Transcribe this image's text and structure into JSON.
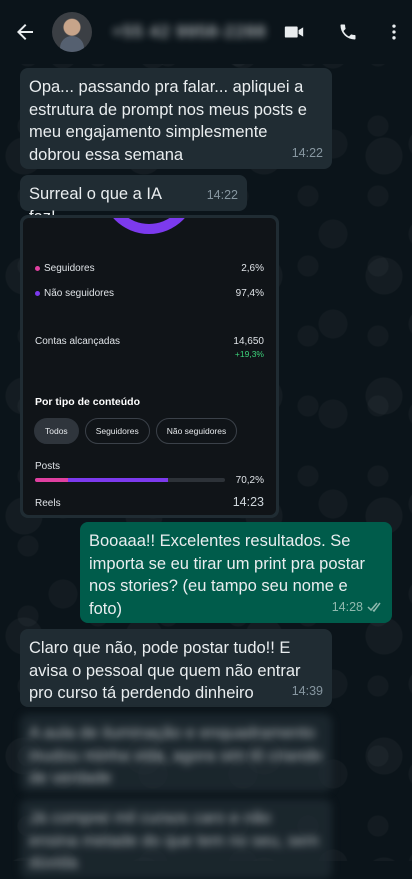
{
  "header": {
    "contact_name": "+55 42 9958-2288",
    "icons": {
      "back": "arrow-left-icon",
      "video": "video-camera-icon",
      "call": "phone-icon",
      "menu": "more-vertical-icon"
    }
  },
  "messages": [
    {
      "type": "in",
      "text": "Opa... passando pra falar... apliquei a estrutura de prompt nos meus posts e meu engajamento simplesmente dobrou essa semana",
      "time": "14:22"
    },
    {
      "type": "in",
      "text": "Surreal o que a IA faz!",
      "time": "14:22"
    },
    {
      "type": "in",
      "text": "Booaaa!! Excelentes resultados. Se importa se eu tirar um print pra postar nos stories? (eu tampo seu nome e foto)",
      "time": "14:28"
    },
    {
      "type": "in",
      "text": "Claro que não, pode postar tudo!! E avisa o pessoal que quem não entrar pro curso tá perdendo dinheiro",
      "time": "14:39"
    },
    {
      "type": "in",
      "text": "A aula de iluminação e enquadramento mudou minha vida, agora sim tô criando de verdade",
      "time": ""
    },
    {
      "type": "in",
      "text": "Já comprei mil cursos caro e não ensina metade do que tem no seu, sem dúvida",
      "time": ""
    }
  ],
  "screenshot": {
    "seguidores_label": "Seguidores",
    "seguidores_value": "2,6%",
    "nao_seguidores_label": "Não seguidores",
    "nao_seguidores_value": "97,4%",
    "contas_label": "Contas alcançadas",
    "contas_value": "14,650",
    "contas_change": "+19,3%",
    "section_title": "Por tipo de conteúdo",
    "chips": [
      "Todos",
      "Seguidores",
      "Não seguidores"
    ],
    "posts_label": "Posts",
    "posts_value": "70,2%",
    "posts_fraction": 0.702,
    "posts_seguidores_fraction": 0.25,
    "reels_label": "Reels",
    "time": "14:23"
  },
  "colors": {
    "incoming": "#202c33",
    "outgoing": "#005c4b",
    "background": "#0b141a",
    "accent_pink": "#e040a0",
    "accent_purple": "#7c3aed",
    "green": "#3dd17a"
  },
  "read_receipt": "double-check-icon"
}
